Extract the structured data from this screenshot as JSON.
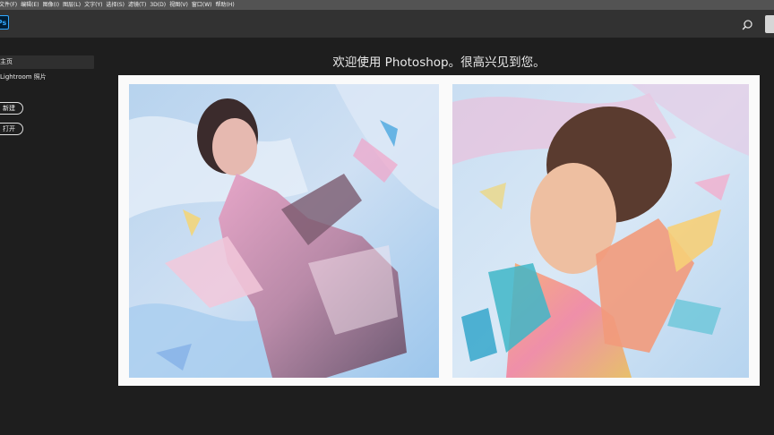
{
  "menubar": {
    "items": [
      "文件(F)",
      "编辑(E)",
      "图像(I)",
      "图层(L)",
      "文字(Y)",
      "选择(S)",
      "滤镜(T)",
      "3D(D)",
      "视图(V)",
      "窗口(W)",
      "帮助(H)"
    ]
  },
  "appbar": {
    "logo_text": "Ps",
    "search_icon": "search-icon"
  },
  "sidebar": {
    "nav": [
      {
        "label": "主页",
        "active": true
      },
      {
        "label": "Lightroom 照片",
        "active": false
      }
    ],
    "new_button": "新建",
    "open_button": "打开"
  },
  "main": {
    "welcome": "欢迎使用 Photoshop。很高兴见到您。"
  },
  "colors": {
    "accent": "#31a8ff",
    "background": "#1e1e1e",
    "appbar": "#323232",
    "menubar": "#535353"
  }
}
